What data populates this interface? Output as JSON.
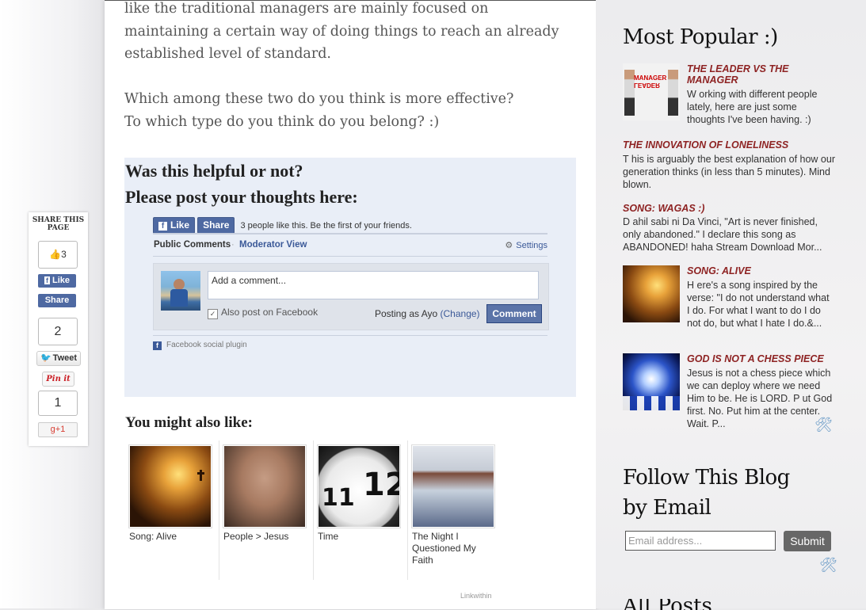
{
  "article": {
    "para1": "like the traditional managers are mainly focused on maintaining a certain way of doing things to reach an already established level of standard.",
    "para2_line1": "Which among these two do you think is more effective?",
    "para2_line2": "To which type do you think do you belong? :)"
  },
  "comments": {
    "heading1": "Was this helpful or not?",
    "heading2": "Please post your thoughts here:",
    "like_label": "Like",
    "share_label": "Share",
    "like_text": "3 people like this. Be the first of your friends.",
    "tab_public": "Public Comments",
    "tab_separator": "·",
    "tab_moderator": "Moderator View",
    "settings_label": "Settings",
    "comment_placeholder": "Add a comment...",
    "also_post": "Also post on Facebook",
    "posting_as": "Posting as Ayo",
    "change_label": "(Change)",
    "comment_button": "Comment",
    "plugin_label": "Facebook social plugin"
  },
  "related": {
    "heading": "You might also like:",
    "items": [
      {
        "caption": "Song: Alive"
      },
      {
        "caption": "People > Jesus"
      },
      {
        "caption": "Time"
      },
      {
        "caption": "The Night I Questioned My Faith"
      }
    ],
    "clock_digits": "12",
    "clock_small": "11",
    "credit": "Linkwithin"
  },
  "share_bar": {
    "title": "SHARE THIS PAGE",
    "like_count": "3",
    "like_label": "Like",
    "share_label": "Share",
    "tweet_count": "2",
    "tweet_label": "Tweet",
    "pinit_label": "Pin it",
    "gplus_count": "1",
    "gplus_label": "g+1"
  },
  "sidebar": {
    "popular_title": "Most Popular :)",
    "posts": [
      {
        "title": "THE LEADER VS THE MANAGER",
        "snippet": "W orking with different people lately, here are just some thoughts I've been having. :)",
        "thumb_text_a": "MANAGER",
        "thumb_text_b": "LEADER"
      },
      {
        "title": "THE INNOVATION OF LONELINESS",
        "snippet": "T his is arguably the best explanation of how our generation thinks (in less than 5 minutes). Mind blown."
      },
      {
        "title": "SONG: WAGAS :)",
        "snippet": "D ahil sabi ni Da Vinci, \"Art is never finished, only abandoned.\" I declare this song as ABANDONED! haha Stream Download Mor..."
      },
      {
        "title": "SONG: ALIVE",
        "snippet": "H ere's a song inspired by the verse: \"I do not understand what I do. For what I want to do I do not do, but what I hate I do.&..."
      },
      {
        "title": "GOD IS NOT A CHESS PIECE",
        "snippet": "Jesus is not a chess piece which we can deploy where we need Him to be. He is LORD. P ut God first. No. Put him at the center. Wait. P..."
      }
    ],
    "follow_title_1": "Follow This Blog",
    "follow_title_2": "by Email",
    "email_placeholder": "Email address...",
    "submit_label": "Submit",
    "next_title": "All Posts"
  },
  "colors": {
    "facebook_blue": "#4e69a2",
    "popular_title_red": "#8e2323",
    "comment_bg": "#e9eef7"
  }
}
